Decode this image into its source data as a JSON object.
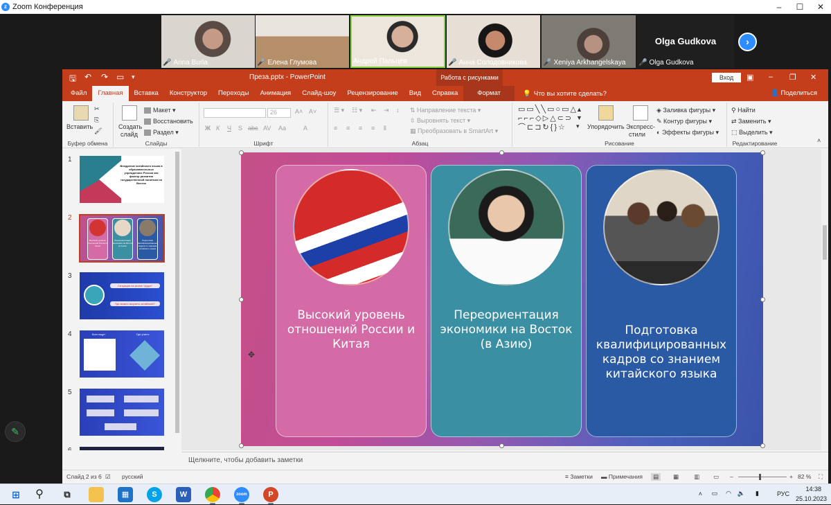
{
  "zoom": {
    "title": "Zoom Конференция",
    "participants": [
      {
        "name": "Anna Burla",
        "muted": true
      },
      {
        "name": "Елена Глумова",
        "muted": true
      },
      {
        "name": "Андрей Пальцев",
        "muted": false
      },
      {
        "name": "Анна Солодовникова",
        "muted": true
      },
      {
        "name": "Xeniya Arkhangelskaya",
        "muted": true
      },
      {
        "name": "Olga Gudkova",
        "muted": true
      }
    ],
    "speaker_display": "Olga Gudkova",
    "window_controls": [
      "–",
      "☐",
      "✕"
    ]
  },
  "powerpoint": {
    "doc_title": "Преза.pptx  -  PowerPoint",
    "context_tab": "Работа с рисунками",
    "login": "Вход",
    "tabs": [
      "Файл",
      "Главная",
      "Вставка",
      "Конструктор",
      "Переходы",
      "Анимация",
      "Слайд-шоу",
      "Рецензирование",
      "Вид",
      "Справка"
    ],
    "format_tab": "Формат",
    "active_tab": "Главная",
    "tell_me": "Что вы хотите сделать?",
    "share": "Поделиться",
    "ribbon": {
      "clipboard": {
        "paste": "Вставить",
        "label": "Буфер обмена"
      },
      "slides": {
        "create": "Создать",
        "create2": "слайд",
        "layout": "Макет",
        "reset": "Восстановить",
        "section": "Раздел",
        "label": "Слайды"
      },
      "font": {
        "size": "26",
        "label": "Шрифт",
        "bold": "Ж",
        "italic": "К",
        "underline": "Ч",
        "shadow": "S",
        "strike": "abc",
        "spacing": "AV",
        "case": "Aa",
        "color": "A"
      },
      "paragraph": {
        "direction": "Направление текста",
        "align": "Выровнять текст",
        "smartart": "Преобразовать в SmartArt",
        "label": "Абзац"
      },
      "drawing": {
        "arrange": "Упорядочить",
        "quick": "Экспресс-",
        "quick2": "стили",
        "fill": "Заливка фигуры",
        "outline": "Контур фигуры",
        "effects": "Эффекты фигуры",
        "label": "Рисование"
      },
      "editing": {
        "find": "Найти",
        "replace": "Заменить",
        "select": "Выделить",
        "label": "Редактирование"
      }
    },
    "thumbnails": [
      {
        "num": "1",
        "title": "Внедрение китайского языка в образовательных учреждениях России как фактор развития государственной политики на Восток"
      },
      {
        "num": "2",
        "captions": [
          "Высокий уровень отношений России и Китая",
          "Переориентация экономики на Восток (в Азию)",
          "Подготовка квалифицированных кадров со знанием китайского языка"
        ]
      },
      {
        "num": "3",
        "lines": [
          "Ситуация на рынке труда?",
          "Где можно выучить китайский?"
        ]
      },
      {
        "num": "4",
        "left": "Кого ищут:",
        "right": "Где учить:"
      },
      {
        "num": "5"
      },
      {
        "num": "6"
      }
    ],
    "selected_slide": 2,
    "slide": {
      "cards": [
        {
          "text": "Высокий уровень отношений России и Китая",
          "color": "#d46aa6"
        },
        {
          "text": "Переориентация экономики на Восток (в Азию)",
          "color": "#3b8fa3"
        },
        {
          "text": "Подготовка квалифицированных кадров со знанием китайского языка",
          "color": "#2b5aa4"
        }
      ]
    },
    "notes_placeholder": "Щелкните, чтобы добавить заметки",
    "status": {
      "slide_info": "Слайд 2 из 6",
      "language": "русский",
      "notes": "Заметки",
      "comments": "Примечания",
      "zoom": "82 %"
    }
  },
  "taskbar": {
    "time": "14:38",
    "date": "25.10.2023",
    "lang": "РУС"
  },
  "colors": {
    "ppt_accent": "#c43e1c",
    "zoom_blue": "#2d8cff"
  }
}
